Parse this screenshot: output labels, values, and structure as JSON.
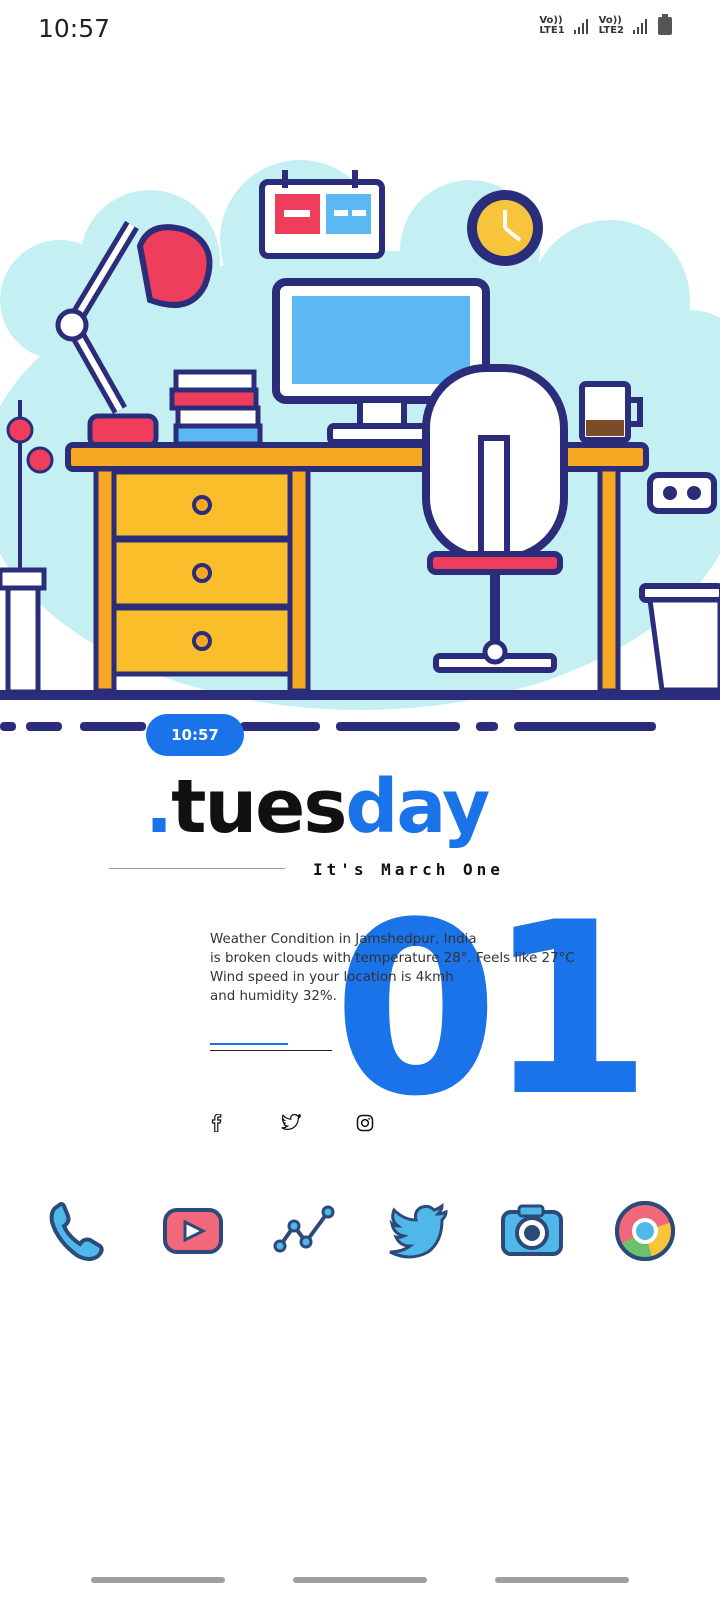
{
  "status_bar": {
    "time": "10:57",
    "sim1_top": "Vo))",
    "sim1_bottom": "LTE1",
    "sim2_top": "Vo))",
    "sim2_bottom": "LTE2"
  },
  "widget": {
    "clock_pill": "10:57",
    "day_dot": ".",
    "day_part1": "tues",
    "day_part2": "day",
    "subtitle": "It's March One",
    "date_number": "01",
    "weather_lines": [
      "Weather Condition in Jamshedpur, India",
      "is broken clouds with temperature 28°. Feels like 27°C",
      "Wind speed in your location is 4kmh",
      "and humidity 32%."
    ]
  },
  "socials": [
    "facebook-icon",
    "twitter-icon",
    "instagram-icon"
  ],
  "dock": [
    "phone-app",
    "youtube-app",
    "stocks-app",
    "twitter-app",
    "camera-app",
    "chrome-app"
  ],
  "colors": {
    "accent": "#1a73e8",
    "navy": "#2b2d7a",
    "sky": "#b9ecf0"
  }
}
